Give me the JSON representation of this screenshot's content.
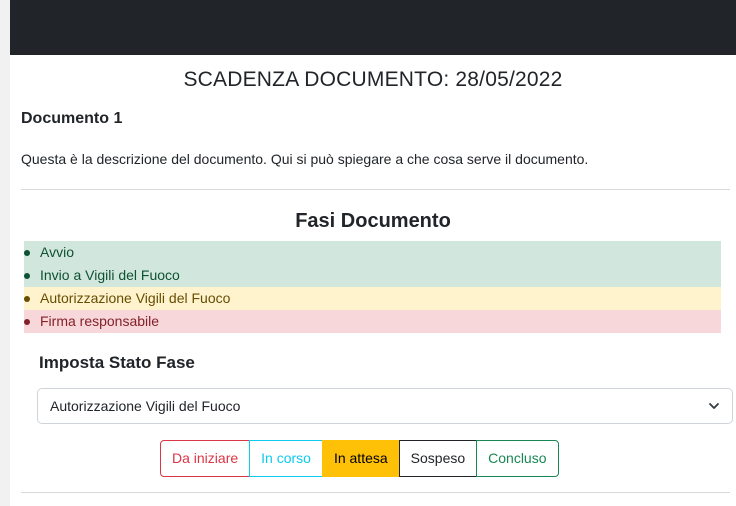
{
  "header": {
    "deadline": "SCADENZA DOCUMENTO: 28/05/2022"
  },
  "document": {
    "name": "Documento 1",
    "description": "Questa è la descrizione del documento. Qui si può spiegare a che cosa serve il documento."
  },
  "phases": {
    "title": "Fasi Documento",
    "items": [
      {
        "label": "Avvio",
        "status": "completed",
        "color": "#d1e7dd"
      },
      {
        "label": "Invio a Vigili del Fuoco",
        "status": "completed",
        "color": "#d1e7dd"
      },
      {
        "label": "Autorizzazione Vigili del Fuoco",
        "status": "waiting",
        "color": "#fff3cd"
      },
      {
        "label": "Firma responsabile",
        "status": "to-start",
        "color": "#f8d7da"
      }
    ]
  },
  "set_status": {
    "title": "Imposta Stato Fase",
    "selected": "Autorizzazione Vigili del Fuoco",
    "buttons": [
      {
        "label": "Da iniziare",
        "color": "#dc3545"
      },
      {
        "label": "In corso",
        "color": "#0dcaf0"
      },
      {
        "label": "In attesa",
        "color": "#ffc107",
        "active": true
      },
      {
        "label": "Sospeso",
        "color": "#212529"
      },
      {
        "label": "Concluso",
        "color": "#198754"
      }
    ]
  }
}
